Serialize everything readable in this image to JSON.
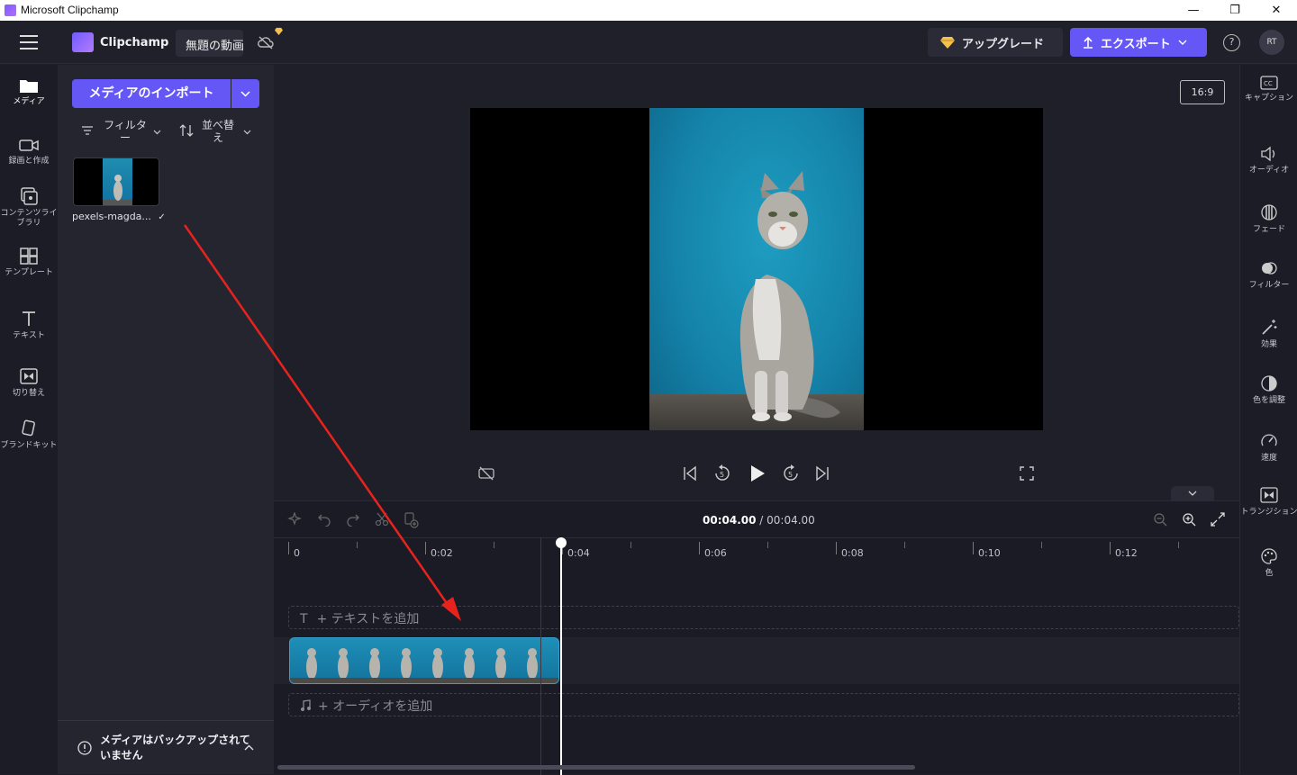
{
  "window": {
    "title": "Microsoft Clipchamp",
    "minimize_glyph": "—",
    "maximize_glyph": "❐",
    "close_glyph": "✕"
  },
  "header": {
    "app_name": "Clipchamp",
    "project_name": "無題の動画",
    "upgrade_label": "アップグレード",
    "export_label": "エクスポート",
    "help_glyph": "?",
    "avatar_initials": "RT",
    "colors": {
      "accent": "#6457f5",
      "gem": "#f2c14e"
    }
  },
  "left_rail": {
    "items": [
      {
        "label": "メディア",
        "icon": "folder-icon",
        "active": true
      },
      {
        "label": "録画と作成",
        "icon": "video-camera-icon"
      },
      {
        "label": "コンテンツライブラリ",
        "icon": "library-icon"
      },
      {
        "label": "テンプレート",
        "icon": "templates-icon"
      },
      {
        "label": "テキスト",
        "icon": "text-icon"
      },
      {
        "label": "切り替え",
        "icon": "transition-icon"
      },
      {
        "label": "ブランドキット",
        "icon": "brand-kit-icon"
      }
    ]
  },
  "media_panel": {
    "import_label": "メディアのインポート",
    "filter_label": "フィルター",
    "sort_label": "並べ替え",
    "items": [
      {
        "name": "pexels-magda...",
        "status": "✓"
      }
    ],
    "backup_notice": "メディアはバックアップされていません"
  },
  "preview": {
    "aspect_ratio": "16:9"
  },
  "timeline": {
    "current_time": "00:04.00",
    "separator": " / ",
    "total_time": "00:04.00",
    "ruler_labels": [
      "0",
      "0:02",
      "0:04",
      "0:06",
      "0:08",
      "0:10",
      "0:12"
    ],
    "text_track_label": "+ テキストを追加",
    "text_track_icon": "T",
    "audio_track_label": "+ オーディオを追加",
    "playhead_seconds": 4.0
  },
  "right_rail": {
    "items": [
      {
        "label": "キャプション",
        "icon": "captions-icon"
      },
      {
        "label": "オーディオ",
        "icon": "speaker-icon"
      },
      {
        "label": "フェード",
        "icon": "fade-icon"
      },
      {
        "label": "フィルター",
        "icon": "filter-icon"
      },
      {
        "label": "効果",
        "icon": "magic-wand-icon"
      },
      {
        "label": "色を調整",
        "icon": "contrast-icon"
      },
      {
        "label": "速度",
        "icon": "speedometer-icon"
      },
      {
        "label": "トランジション",
        "icon": "transition-icon"
      },
      {
        "label": "色",
        "icon": "palette-icon"
      }
    ]
  },
  "annotation": {
    "arrow_color": "#e8231e"
  }
}
